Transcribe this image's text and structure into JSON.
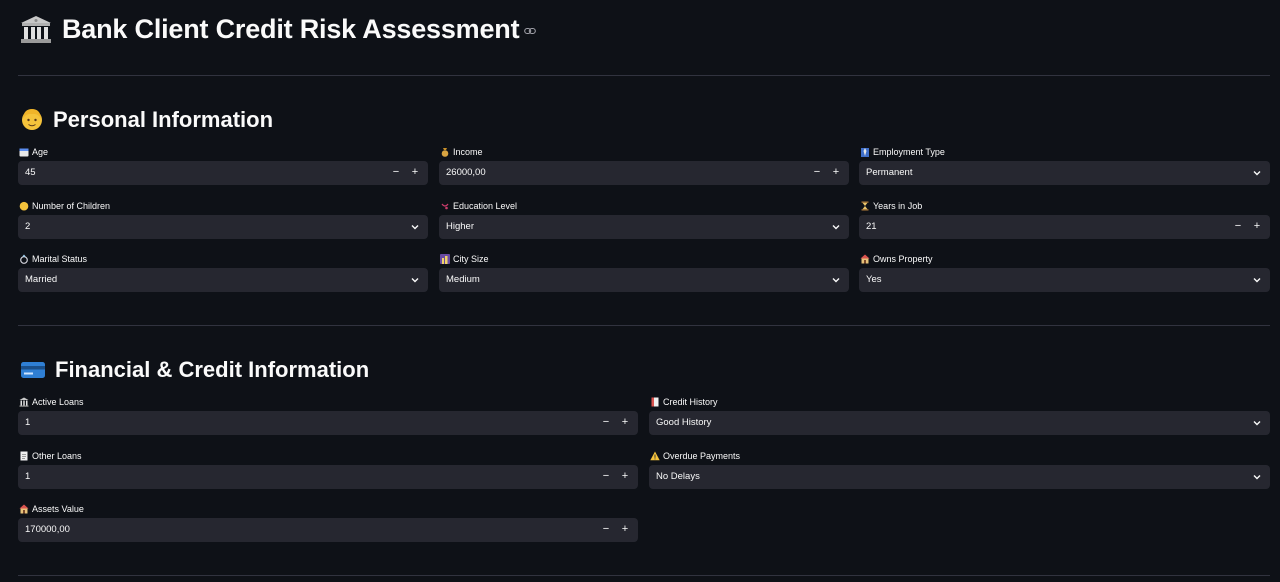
{
  "app": {
    "title": "Bank Client Credit Risk Assessment",
    "title_icon": "bank-building-icon",
    "anchor_icon": "link-icon"
  },
  "sections": {
    "personal": {
      "title": "Personal Information",
      "icon": "person-icon"
    },
    "financial": {
      "title": "Financial & Credit Information",
      "icon": "credit-card-icon"
    }
  },
  "fields": {
    "age": {
      "label": "Age",
      "value": "45",
      "icon": "calendar-icon"
    },
    "income": {
      "label": "Income",
      "value": "26000,00",
      "icon": "money-bag-icon"
    },
    "employment_type": {
      "label": "Employment Type",
      "value": "Permanent",
      "icon": "suit-icon"
    },
    "children": {
      "label": "Number of Children",
      "value": "2",
      "icon": "child-face-icon"
    },
    "education": {
      "label": "Education Level",
      "value": "Higher",
      "icon": "graduation-icon"
    },
    "years_in_job": {
      "label": "Years in Job",
      "value": "21",
      "icon": "hourglass-icon"
    },
    "marital_status": {
      "label": "Marital Status",
      "value": "Married",
      "icon": "ring-icon"
    },
    "city_size": {
      "label": "City Size",
      "value": "Medium",
      "icon": "city-icon"
    },
    "owns_property": {
      "label": "Owns Property",
      "value": "Yes",
      "icon": "house-icon"
    },
    "active_loans": {
      "label": "Active Loans",
      "value": "1",
      "icon": "bank-icon"
    },
    "credit_history": {
      "label": "Credit History",
      "value": "Good History",
      "icon": "document-icon"
    },
    "other_loans": {
      "label": "Other Loans",
      "value": "1",
      "icon": "page-icon"
    },
    "overdue_payments": {
      "label": "Overdue Payments",
      "value": "No Delays",
      "icon": "warning-icon"
    },
    "assets_value": {
      "label": "Assets Value",
      "value": "170000,00",
      "icon": "house-icon"
    }
  },
  "controls": {
    "minus": "−",
    "plus": "+"
  },
  "colors": {
    "background": "#0e1117",
    "input_background": "#262730",
    "divider": "#31333f",
    "text": "#fafafa"
  }
}
